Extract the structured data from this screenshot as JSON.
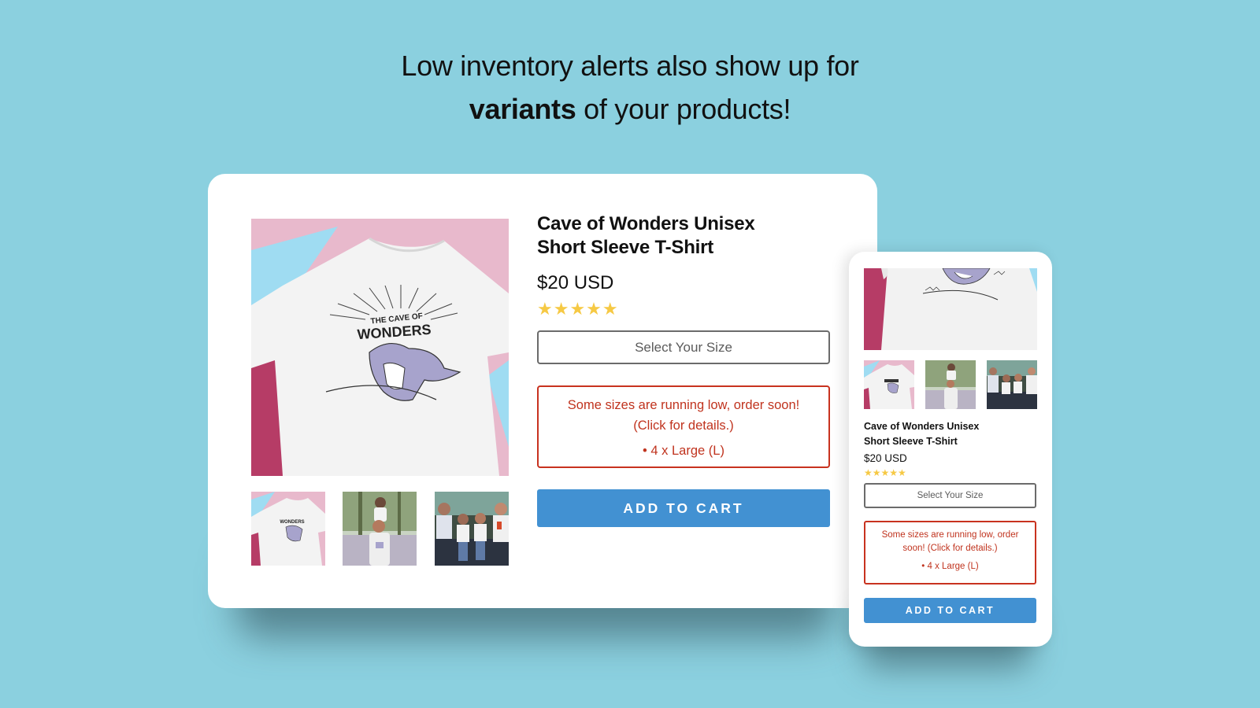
{
  "headline": {
    "line1": "Low inventory alerts also show up for",
    "line2_bold": "variants",
    "line2_rest": " of your products!"
  },
  "product": {
    "title_line1": "Cave of Wonders Unisex",
    "title_line2": "Short Sleeve T-Shirt",
    "price": "$20 USD",
    "rating": 5,
    "rating_max": 5,
    "stars": "★★★★★",
    "size_select_label": "Select Your Size",
    "add_to_cart_label": "ADD TO CART",
    "shirt_print_line1": "THE CAVE OF",
    "shirt_print_line2": "WONDERS"
  },
  "alert": {
    "message": "Some sizes are running low, order soon!",
    "cta": "(Click for details.)",
    "message_mobile_line1": "Some sizes are running low, order",
    "message_mobile_line2": "soon! (Click for details.)",
    "variants": [
      {
        "quantity": 4,
        "label": "• 4 x Large (L)"
      }
    ]
  },
  "thumbnails": [
    {
      "name": "shirt-flat-lay"
    },
    {
      "name": "father-daughter-photo"
    },
    {
      "name": "family-photo"
    }
  ],
  "colors": {
    "background": "#8bd0df",
    "alert_red": "#c0331e",
    "button_blue": "#4291d2",
    "star_yellow": "#f6c944",
    "print_purple": "#a7a3cc",
    "backdrop_pink": "#e8b9cc",
    "backdrop_magenta": "#b63c66",
    "backdrop_blue": "#9fdcf2"
  }
}
